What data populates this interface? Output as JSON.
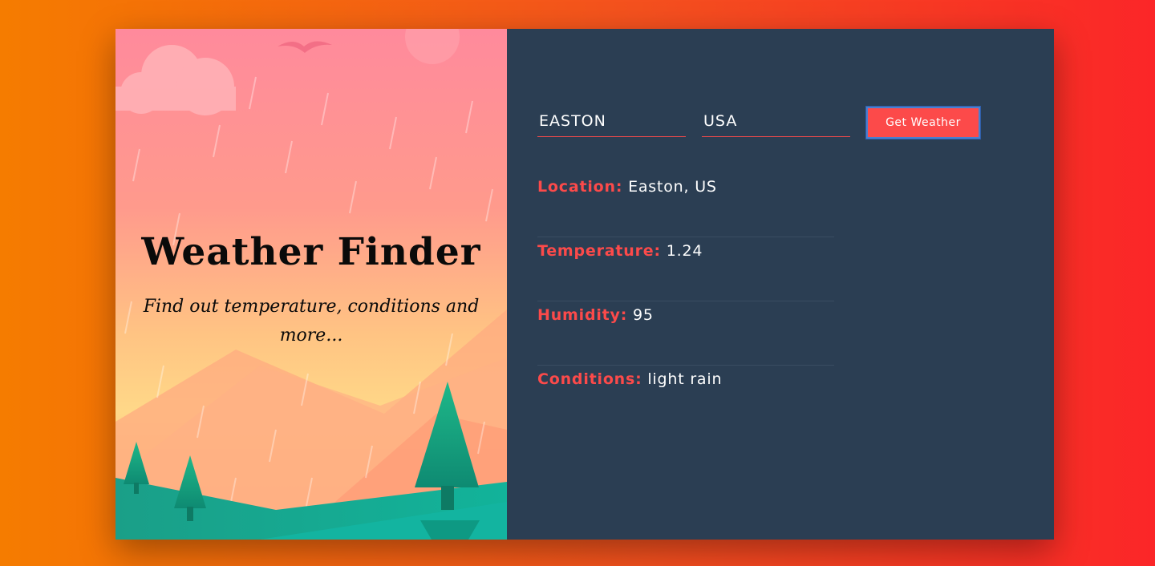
{
  "hero": {
    "title": "Weather Finder",
    "subtitle": "Find out temperature, conditions and more..."
  },
  "form": {
    "city_value": "EASTON",
    "country_value": "USA",
    "submit_label": "Get Weather"
  },
  "results": [
    {
      "label": "Location:",
      "value": "Easton, US"
    },
    {
      "label": "Temperature:",
      "value": "1.24"
    },
    {
      "label": "Humidity:",
      "value": "95"
    },
    {
      "label": "Conditions:",
      "value": "light rain"
    }
  ],
  "colors": {
    "accent": "#fc4a4a",
    "panel": "#2b3e53",
    "background_start": "#f57c00",
    "background_end": "#fb2628"
  },
  "icons": [
    "cloud-illustration",
    "bird-illustration",
    "rain-illustration",
    "mountain-illustration",
    "tree-illustration"
  ]
}
